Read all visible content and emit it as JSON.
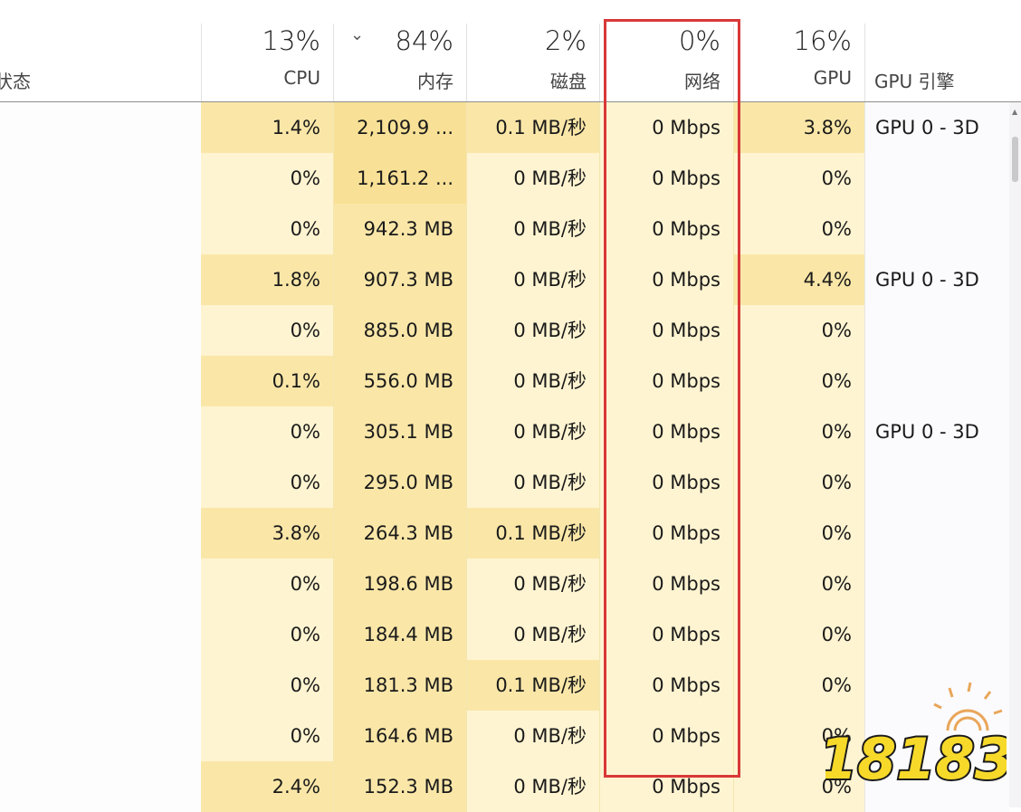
{
  "header": {
    "status_label": "状态",
    "columns": [
      {
        "key": "cpu",
        "percent": "13%",
        "label": "CPU"
      },
      {
        "key": "memory",
        "percent": "84%",
        "label": "内存",
        "sorted": true,
        "sort_icon": "chevron-down"
      },
      {
        "key": "disk",
        "percent": "2%",
        "label": "磁盘"
      },
      {
        "key": "network",
        "percent": "0%",
        "label": "网络"
      },
      {
        "key": "gpu",
        "percent": "16%",
        "label": "GPU"
      },
      {
        "key": "gpu_engine",
        "label": "GPU 引擎"
      }
    ]
  },
  "rows": [
    {
      "cpu": "1.4%",
      "memory": "2,109.9 ...",
      "disk": "0.1 MB/秒",
      "network": "0 Mbps",
      "gpu": "3.8%",
      "gpu_engine": "GPU 0 - 3D"
    },
    {
      "cpu": "0%",
      "memory": "1,161.2 ...",
      "disk": "0 MB/秒",
      "network": "0 Mbps",
      "gpu": "0%",
      "gpu_engine": ""
    },
    {
      "cpu": "0%",
      "memory": "942.3 MB",
      "disk": "0 MB/秒",
      "network": "0 Mbps",
      "gpu": "0%",
      "gpu_engine": ""
    },
    {
      "cpu": "1.8%",
      "memory": "907.3 MB",
      "disk": "0 MB/秒",
      "network": "0 Mbps",
      "gpu": "4.4%",
      "gpu_engine": "GPU 0 - 3D"
    },
    {
      "cpu": "0%",
      "memory": "885.0 MB",
      "disk": "0 MB/秒",
      "network": "0 Mbps",
      "gpu": "0%",
      "gpu_engine": ""
    },
    {
      "cpu": "0.1%",
      "memory": "556.0 MB",
      "disk": "0 MB/秒",
      "network": "0 Mbps",
      "gpu": "0%",
      "gpu_engine": ""
    },
    {
      "cpu": "0%",
      "memory": "305.1 MB",
      "disk": "0 MB/秒",
      "network": "0 Mbps",
      "gpu": "0%",
      "gpu_engine": "GPU 0 - 3D"
    },
    {
      "cpu": "0%",
      "memory": "295.0 MB",
      "disk": "0 MB/秒",
      "network": "0 Mbps",
      "gpu": "0%",
      "gpu_engine": ""
    },
    {
      "cpu": "3.8%",
      "memory": "264.3 MB",
      "disk": "0.1 MB/秒",
      "network": "0 Mbps",
      "gpu": "0%",
      "gpu_engine": ""
    },
    {
      "cpu": "0%",
      "memory": "198.6 MB",
      "disk": "0 MB/秒",
      "network": "0 Mbps",
      "gpu": "0%",
      "gpu_engine": ""
    },
    {
      "cpu": "0%",
      "memory": "184.4 MB",
      "disk": "0 MB/秒",
      "network": "0 Mbps",
      "gpu": "0%",
      "gpu_engine": ""
    },
    {
      "cpu": "0%",
      "memory": "181.3 MB",
      "disk": "0.1 MB/秒",
      "network": "0 Mbps",
      "gpu": "0%",
      "gpu_engine": ""
    },
    {
      "cpu": "0%",
      "memory": "164.6 MB",
      "disk": "0 MB/秒",
      "network": "0 Mbps",
      "gpu": "0%",
      "gpu_engine": ""
    },
    {
      "cpu": "2.4%",
      "memory": "152.3 MB",
      "disk": "0 MB/秒",
      "network": "0 Mbps",
      "gpu": "0%",
      "gpu_engine": ""
    }
  ],
  "highlight": {
    "column": "network",
    "color": "#d93838"
  },
  "watermark": {
    "text": "18183"
  },
  "colors": {
    "heat_light": "#fff4d1",
    "heat_mid": "#fcefc1",
    "heat_strong": "#fae7a8",
    "heat_max": "#f8e196"
  }
}
